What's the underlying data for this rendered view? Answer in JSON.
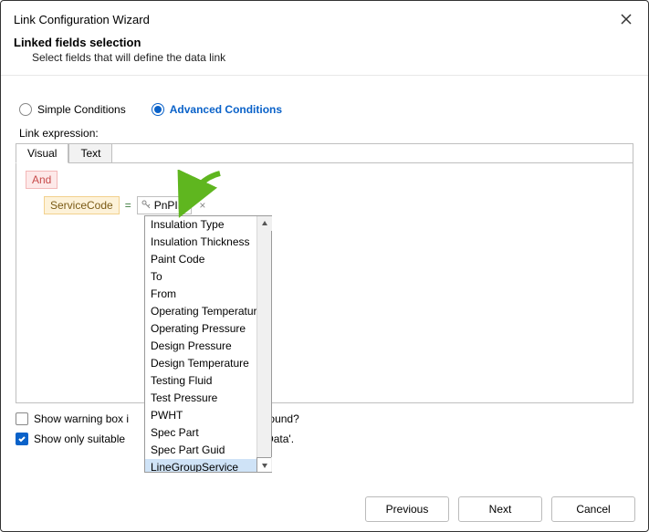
{
  "window": {
    "title": "Link Configuration Wizard"
  },
  "header": {
    "title": "Linked fields selection",
    "subtitle": "Select fields that will define the data link"
  },
  "radios": {
    "simple": "Simple Conditions",
    "advanced": "Advanced Conditions",
    "selected": "advanced"
  },
  "expression": {
    "label": "Link expression:",
    "tabs": {
      "visual": "Visual",
      "text": "Text",
      "active": "visual"
    },
    "root_op": "And",
    "condition": {
      "field": "ServiceCode",
      "operator": "=",
      "value": "PnPID"
    }
  },
  "dropdown": {
    "items": [
      "Insulation Type",
      "Insulation Thickness",
      "Paint Code",
      "To",
      "From",
      "Operating Temperature",
      "Operating Pressure",
      "Design Pressure",
      "Design Temperature",
      "Testing Fluid",
      "Test Pressure",
      "PWHT",
      "Spec Part",
      "Spec Part Guid",
      "LineGroupService"
    ],
    "highlighted": "LineGroupService"
  },
  "options": {
    "warn_label_visible_left": "Show warning box i",
    "warn_label_visible_right": "e found?",
    "warn_checked": false,
    "suitable_label_visible_left": "Show only suitable",
    "suitable_label_visible_right": "n Data'.",
    "suitable_checked": true
  },
  "footer": {
    "previous": "Previous",
    "next": "Next",
    "cancel": "Cancel"
  }
}
